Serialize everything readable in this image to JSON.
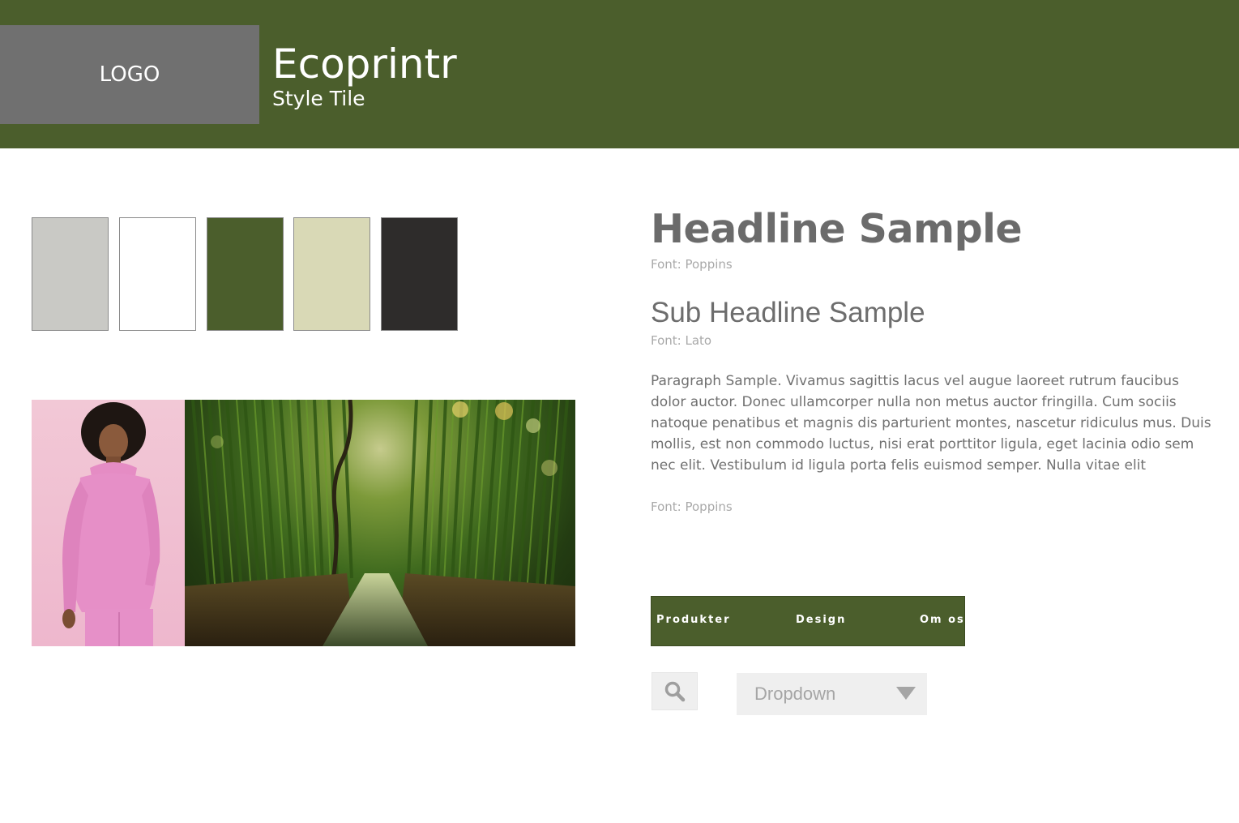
{
  "header": {
    "logo_label": "LOGO",
    "brand_title": "Ecoprintr",
    "brand_subtitle": "Style Tile"
  },
  "palette": {
    "swatches": [
      {
        "name": "light-gray",
        "color": "#c9c9c5"
      },
      {
        "name": "white",
        "color": "#ffffff"
      },
      {
        "name": "forest-green",
        "color": "#4b5e2c"
      },
      {
        "name": "sage",
        "color": "#d9d9b6"
      },
      {
        "name": "charcoal",
        "color": "#2e2c2b"
      }
    ]
  },
  "typography": {
    "headline": "Headline Sample",
    "headline_font_note": "Font: Poppins",
    "subheadline": "Sub Headline Sample",
    "subheadline_font_note": "Font: Lato",
    "paragraph": "Paragraph Sample. Vivamus sagittis lacus vel augue laoreet rutrum faucibus dolor auctor. Donec ullamcorper nulla non metus auctor fringilla. Cum sociis natoque penatibus et magnis dis parturient montes, nascetur ridiculus mus. Duis mollis, est non commodo luctus, nisi erat porttitor ligula, eget lacinia odio sem nec elit. Vestibulum id ligula porta felis euismod semper. Nulla vitae elit",
    "paragraph_font_note": "Font: Poppins"
  },
  "nav": {
    "items": [
      "Produkter",
      "Design",
      "Om os"
    ]
  },
  "controls": {
    "search_icon": "search-icon",
    "dropdown_label": "Dropdown",
    "dropdown_icon": "triangle-down-icon"
  },
  "colors": {
    "brand_green": "#4b5e2c",
    "logo_gray": "#707070",
    "text_gray": "#6b6b6b",
    "note_gray": "#a9a9a9",
    "control_bg": "#efefef"
  }
}
